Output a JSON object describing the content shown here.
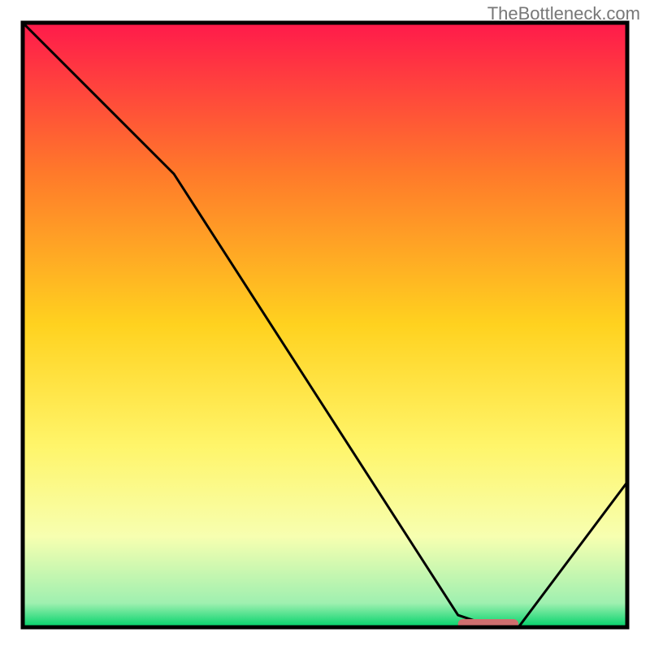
{
  "attribution": "TheBottleneck.com",
  "chart_data": {
    "type": "line",
    "title": "",
    "xlabel": "",
    "ylabel": "",
    "xlim": [
      0,
      100
    ],
    "ylim": [
      0,
      100
    ],
    "x": [
      0,
      25,
      72,
      78,
      82,
      100
    ],
    "values": [
      100,
      75,
      2,
      0,
      0,
      24
    ],
    "marker": {
      "x_start": 72,
      "x_end": 82,
      "color": "#cf6f6f"
    },
    "gradient_stops": [
      {
        "offset": 0,
        "color": "#ff1a4b"
      },
      {
        "offset": 0.25,
        "color": "#ff7a2a"
      },
      {
        "offset": 0.5,
        "color": "#ffd21f"
      },
      {
        "offset": 0.7,
        "color": "#fff56a"
      },
      {
        "offset": 0.85,
        "color": "#f7ffb0"
      },
      {
        "offset": 0.96,
        "color": "#9ff0b0"
      },
      {
        "offset": 1.0,
        "color": "#00d26a"
      }
    ],
    "border_color": "#000000"
  }
}
